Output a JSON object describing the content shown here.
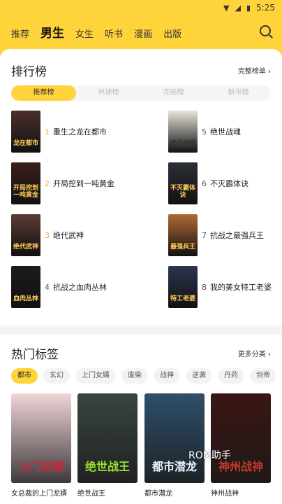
{
  "status": {
    "time": "5:25"
  },
  "nav": {
    "tabs": [
      "推荐",
      "男生",
      "女生",
      "听书",
      "漫画",
      "出版"
    ],
    "active_index": 1
  },
  "ranking": {
    "title": "排行榜",
    "more": "完整榜单",
    "tabs": [
      "推荐榜",
      "热读榜",
      "完结榜",
      "新书榜"
    ],
    "active_tab": 0,
    "items": [
      {
        "rank": "1",
        "name": "重生之龙在都市",
        "cover_text": "龙在都市",
        "cover_color": "#4a2f2a"
      },
      {
        "rank": "2",
        "name": "开局挖到一吨黄金",
        "cover_text": "开局挖到一吨黄金",
        "cover_color": "#3b1f1a"
      },
      {
        "rank": "3",
        "name": "绝代武神",
        "cover_text": "绝代武神",
        "cover_color": "#5a3a36"
      },
      {
        "rank": "4",
        "name": "抗战之血肉丛林",
        "cover_text": "血肉丛林",
        "cover_color": "#1e1b1b"
      },
      {
        "rank": "5",
        "name": "绝世战魂",
        "cover_text": "绝世战魂",
        "cover_color": "#e9e4dc"
      },
      {
        "rank": "6",
        "name": "不灭霸体诀",
        "cover_text": "不灭霸体诀",
        "cover_color": "#2d2f38"
      },
      {
        "rank": "7",
        "name": "抗战之最强兵王",
        "cover_text": "最强兵王",
        "cover_color": "#b06a35"
      },
      {
        "rank": "8",
        "name": "我的美女特工老婆",
        "cover_text": "特工老婆",
        "cover_color": "#2a3550"
      }
    ]
  },
  "hot_tags": {
    "title": "热门标签",
    "more": "更多分类",
    "chips": [
      "都市",
      "玄幻",
      "上门女婿",
      "废柴",
      "战神",
      "逆袭",
      "丹药",
      "剑帝"
    ],
    "active_chip": 0,
    "books": [
      {
        "name": "女总裁的上门龙婿",
        "cover_text": "上门龙婿",
        "cover_color": "#f2d6d8",
        "text_color": "#d0243a"
      },
      {
        "name": "绝世战王",
        "cover_text": "绝世战王",
        "cover_color": "#3a4640",
        "text_color": "#9be12d"
      },
      {
        "name": "都市潜龙",
        "cover_text": "都市潜龙",
        "cover_color": "#2e4f6a",
        "text_color": "#e8f2ff"
      },
      {
        "name": "神州战神",
        "cover_text": "神州战神",
        "cover_color": "#3a1612",
        "text_color": "#c23b2a"
      }
    ]
  },
  "watermark": "ROM助手"
}
